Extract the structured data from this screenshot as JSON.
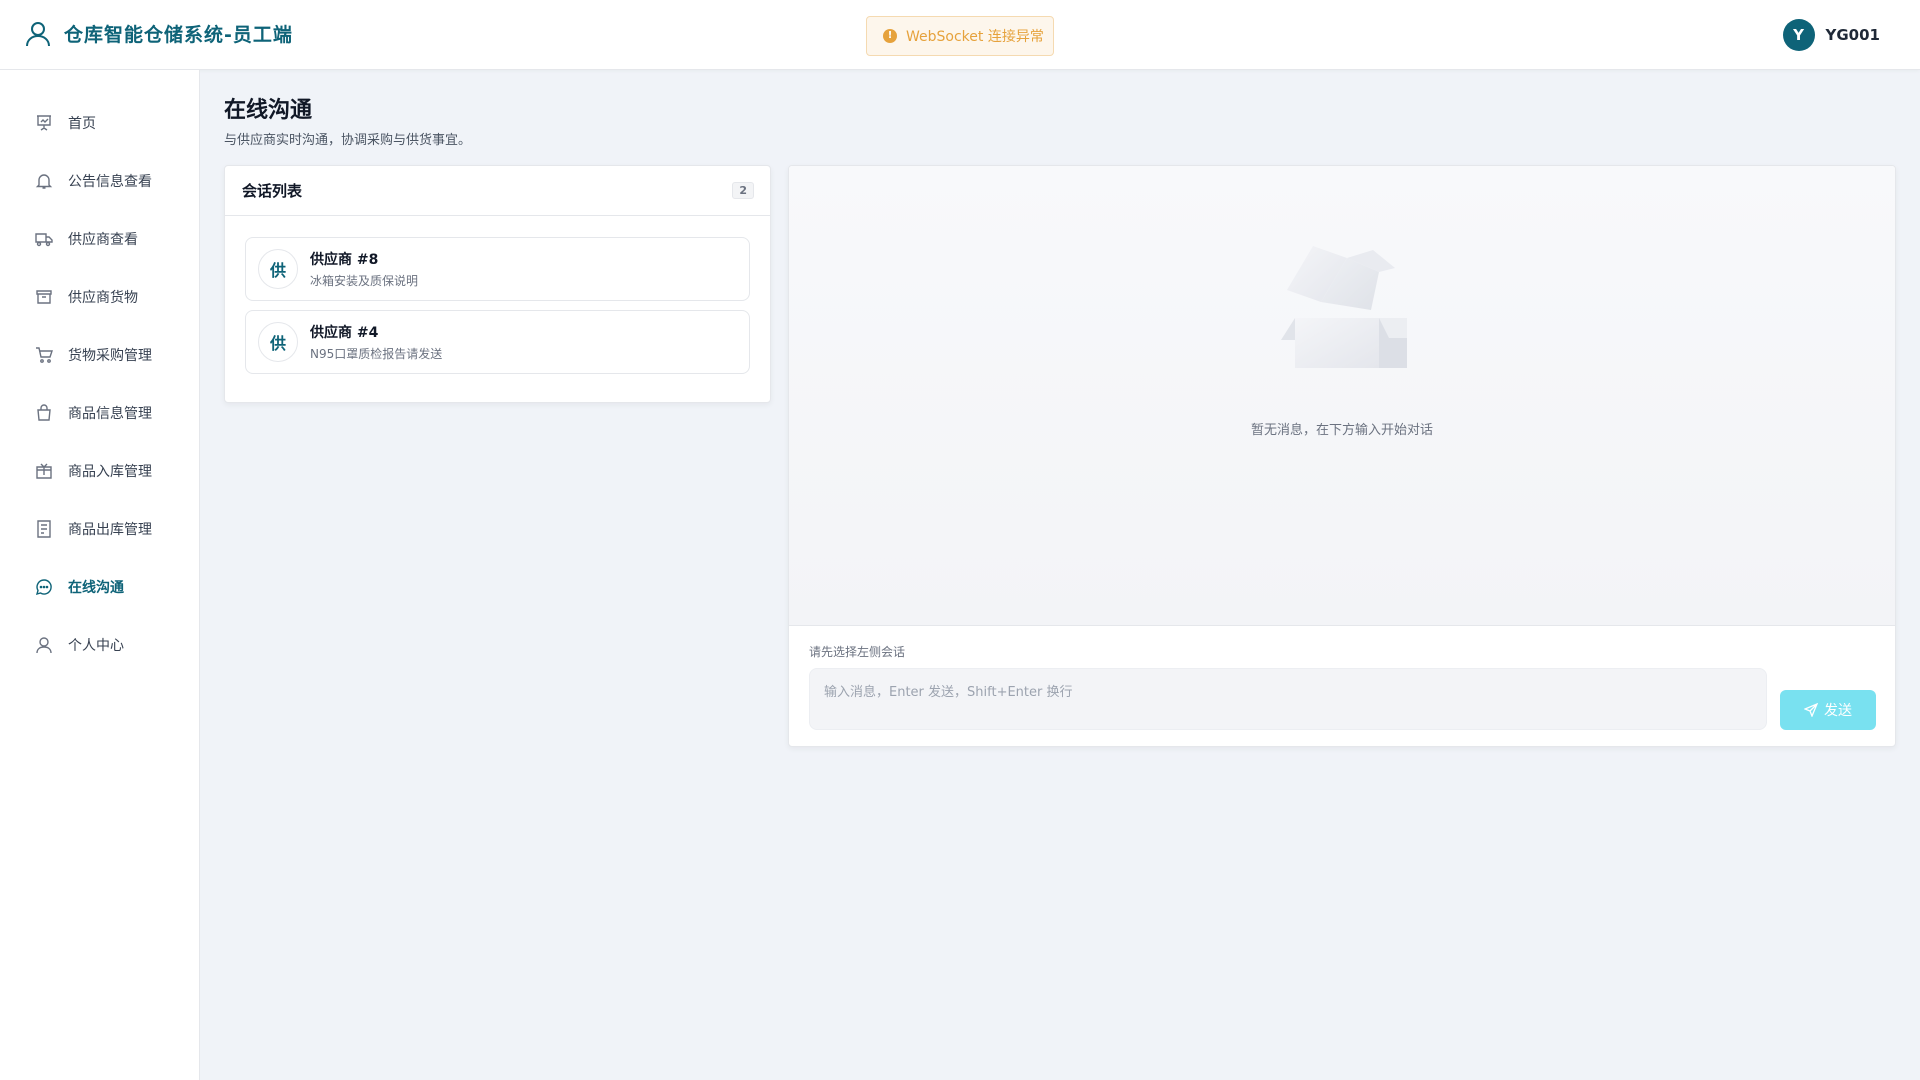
{
  "header": {
    "title": "仓库智能仓储系统-员工端",
    "alert": "WebSocket 连接异常",
    "user": {
      "avatar_letter": "Y",
      "name": "YG001"
    }
  },
  "sidebar": {
    "items": [
      {
        "label": "首页",
        "icon": "presentation-icon",
        "active": false
      },
      {
        "label": "公告信息查看",
        "icon": "bell-icon",
        "active": false
      },
      {
        "label": "供应商查看",
        "icon": "truck-icon",
        "active": false
      },
      {
        "label": "供应商货物",
        "icon": "archive-box-icon",
        "active": false
      },
      {
        "label": "货物采购管理",
        "icon": "cart-icon",
        "active": false
      },
      {
        "label": "商品信息管理",
        "icon": "shopping-bag-icon",
        "active": false
      },
      {
        "label": "商品入库管理",
        "icon": "box-in-icon",
        "active": false
      },
      {
        "label": "商品出库管理",
        "icon": "document-icon",
        "active": false
      },
      {
        "label": "在线沟通",
        "icon": "chat-icon",
        "active": true
      },
      {
        "label": "个人中心",
        "icon": "user-icon",
        "active": false
      }
    ]
  },
  "page": {
    "title": "在线沟通",
    "subtitle": "与供应商实时沟通，协调采购与供货事宜。"
  },
  "conversations": {
    "title": "会话列表",
    "count": "2",
    "items": [
      {
        "avatar": "供",
        "name": "供应商 #8",
        "preview": "冰箱安装及质保说明"
      },
      {
        "avatar": "供",
        "name": "供应商 #4",
        "preview": "N95口罩质检报告请发送"
      }
    ]
  },
  "chat": {
    "empty_text": "暂无消息，在下方输入开始对话",
    "hint": "请先选择左侧会话",
    "input_placeholder": "输入消息，Enter 发送，Shift+Enter 换行",
    "send_label": "发送"
  },
  "colors": {
    "brand": "#0e6378",
    "warning": "#e6a23c",
    "send_button": "#79e1f0"
  }
}
